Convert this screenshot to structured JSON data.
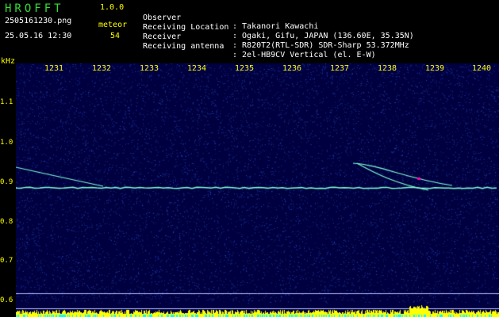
{
  "app": {
    "name": "HROFFT",
    "version": "1.0.0"
  },
  "file": {
    "name": "2505161230.png",
    "datetime": "25.05.16 12:30"
  },
  "meteor": {
    "label": "meteor",
    "count": "54"
  },
  "info": [
    {
      "label": "Observer",
      "value": ": Takanori Kawachi"
    },
    {
      "label": "Receiving Location",
      "value": ": Ogaki, Gifu, JAPAN (136.60E, 35.35N)"
    },
    {
      "label": "Receiver",
      "value": ": R820T2(RTL-SDR) SDR-Sharp 53.372MHz"
    },
    {
      "label": "Receiving antenna",
      "value": ": 2el-HB9CV Vertical (el. E-W)"
    }
  ],
  "spectrogram": {
    "y_axis_unit": "kHz",
    "y_ticks": [
      "1.1",
      "1.0",
      "0.9",
      "0.8",
      "0.7",
      "0.6"
    ],
    "x_ticks": [
      "1231",
      "1232",
      "1233",
      "1234",
      "1235",
      "1236",
      "1237",
      "1238",
      "1239",
      "1240"
    ],
    "colors": {
      "background": "#000040",
      "noise": "#1d3cc8",
      "signal": "#7fffd4",
      "axis_text": "#ffff00",
      "hot": "#ff00aa"
    }
  }
}
